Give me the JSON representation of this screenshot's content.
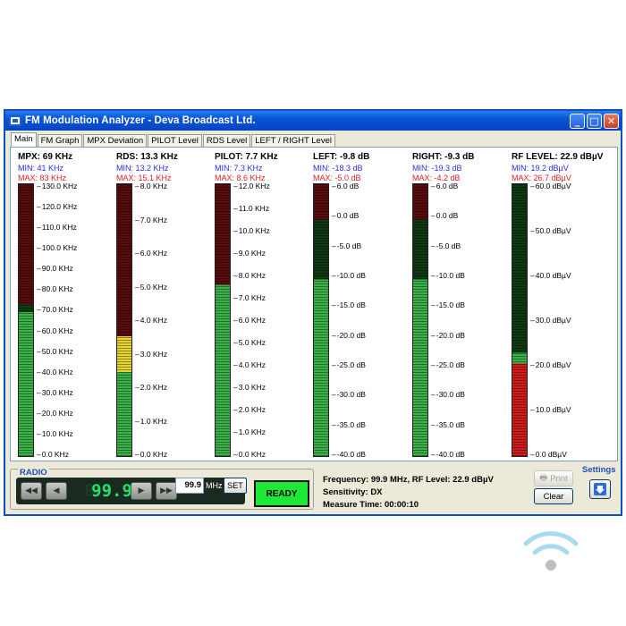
{
  "window": {
    "title": "FM Modulation Analyzer - Deva Broadcast Ltd."
  },
  "tabs": [
    "Main",
    "FM Graph",
    "MPX Deviation",
    "PILOT Level",
    "RDS Level",
    "LEFT / RIGHT Level"
  ],
  "meters": [
    {
      "id": "mpx",
      "title": "MPX:  69 KHz",
      "min": "MIN:  41 KHz",
      "max": "MAX:  83 KHz",
      "level": 0.53,
      "low_color": "#3bb14a",
      "warn_level": 0.56,
      "warn_color": "#3bb14a",
      "ticks": [
        "130.0 KHz",
        "120.0 KHz",
        "110.0 KHz",
        "100.0 KHz",
        "90.0 KHz",
        "80.0 KHz",
        "70.0 KHz",
        "60.0 KHz",
        "50.0 KHz",
        "40.0 KHz",
        "30.0 KHz",
        "20.0 KHz",
        "10.0 KHz",
        "0.0 KHz"
      ]
    },
    {
      "id": "rds",
      "title": "RDS: 13.3 KHz",
      "min": "MIN: 13.2 KHz",
      "max": "MAX: 15.1 KHz",
      "level": 0.31,
      "low_color": "#3bb14a",
      "warn_level": 0.44,
      "warn_color": "#e6d530",
      "ticks": [
        "8.0 KHz",
        "7.0 KHz",
        "6.0 KHz",
        "5.0 KHz",
        "4.0 KHz",
        "3.0 KHz",
        "2.0 KHz",
        "1.0 KHz",
        "0.0 KHz"
      ]
    },
    {
      "id": "pilot",
      "title": "PILOT: 7.7 KHz",
      "min": "MIN: 7.3 KHz",
      "max": "MAX: 8.6 KHz",
      "level": 0.63,
      "low_color": "#3bb14a",
      "warn_level": 0.63,
      "warn_color": "#3bb14a",
      "ticks": [
        "12.0 KHz",
        "11.0 KHz",
        "10.0 KHz",
        "9.0 KHz",
        "8.0 KHz",
        "7.0 KHz",
        "6.0 KHz",
        "5.0 KHz",
        "4.0 KHz",
        "3.0 KHz",
        "2.0 KHz",
        "1.0 KHz",
        "0.0 KHz"
      ]
    },
    {
      "id": "left",
      "title": "LEFT: -9.8 dB",
      "min": "MIN: -18.3 dB",
      "max": "MAX: -5.0 dB",
      "level": 0.65,
      "low_color": "#3bb14a",
      "warn_level": 0.87,
      "warn_color": "#3bb14a",
      "ticks": [
        "6.0 dB",
        "0.0 dB",
        "-5.0 dB",
        "-10.0 dB",
        "-15.0 dB",
        "-20.0 dB",
        "-25.0 dB",
        "-30.0 dB",
        "-35.0 dB",
        "-40.0 dB"
      ]
    },
    {
      "id": "right",
      "title": "RIGHT: -9.3 dB",
      "min": "MIN: -19.3 dB",
      "max": "MAX: -4.2 dB",
      "level": 0.65,
      "low_color": "#3bb14a",
      "warn_level": 0.87,
      "warn_color": "#3bb14a",
      "ticks": [
        "6.0 dB",
        "0.0 dB",
        "-5.0 dB",
        "-10.0 dB",
        "-15.0 dB",
        "-20.0 dB",
        "-25.0 dB",
        "-30.0 dB",
        "-35.0 dB",
        "-40.0 dB"
      ]
    },
    {
      "id": "rf",
      "title": "RF LEVEL: 22.9 dBµV",
      "min": "MIN: 19.2 dBµV",
      "max": "MAX: 26.7 dBµV",
      "level": 0.38,
      "low_color": "#d21b1b",
      "warn_level": 0.38,
      "warn_color": "#3bb14a",
      "low_split": 0.34,
      "ticks": [
        "60.0 dBµV",
        "50.0 dBµV",
        "40.0 dBµV",
        "30.0 dBµV",
        "20.0 dBµV",
        "10.0 dBµV",
        "0.0 dBµV"
      ]
    }
  ],
  "radio": {
    "label": "RADIO",
    "display": "99.9",
    "freq_input": "99.9",
    "unit": "MHz",
    "set_label": "SET",
    "status": "READY"
  },
  "info": {
    "line1": "Frequency: 99.9 MHz, RF Level: 22.9 dBµV",
    "line2": "Sensitivity: DX",
    "line3": "Measure Time: 00:00:10"
  },
  "buttons": {
    "print": "Print",
    "clear": "Clear",
    "settings": "Settings"
  },
  "colors": {
    "titlebar": "#0953d6",
    "ready": "#1ee836",
    "lcd": "#21e16b",
    "bar_dark_red": "#5a0b0b",
    "bar_dark_green": "#0f3a14"
  }
}
